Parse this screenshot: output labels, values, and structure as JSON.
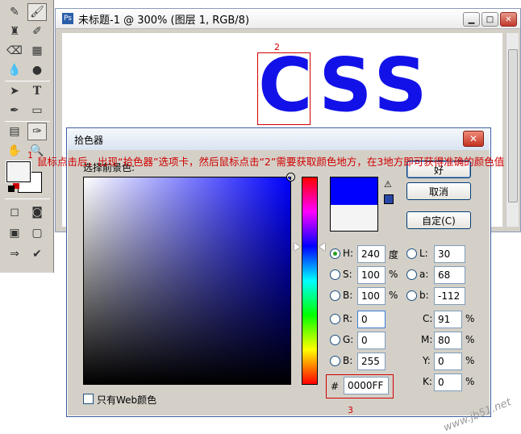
{
  "document": {
    "title": "未标题-1 @ 300% (图层 1, RGB/8)",
    "canvas_text": "CSS"
  },
  "annotations": {
    "marker_1": "1",
    "marker_2": "2",
    "marker_3": "3",
    "note": "鼠标点击后，出现“拾色器”选项卡，然后鼠标点击“2”需要获取颜色地方，在3地方即可获得准确的颜色值"
  },
  "picker": {
    "title": "拾色器",
    "label": "选择前景色:",
    "ok_label": "好",
    "cancel_label": "取消",
    "custom_label": "自定(C)",
    "web_only_label": "只有Web颜色",
    "hsb": {
      "h_label": "H:",
      "h_value": "240",
      "h_unit": "度",
      "s_label": "S:",
      "s_value": "100",
      "s_unit": "%",
      "b_label": "B:",
      "b_value": "100",
      "b_unit": "%"
    },
    "rgb": {
      "r_label": "R:",
      "r_value": "0",
      "g_label": "G:",
      "g_value": "0",
      "b_label": "B:",
      "b_value": "255"
    },
    "lab": {
      "l_label": "L:",
      "l_value": "30",
      "a_label": "a:",
      "a_value": "68",
      "b_label": "b:",
      "b_value": "-112"
    },
    "cmyk": {
      "c_label": "C:",
      "c_value": "91",
      "c_unit": "%",
      "m_label": "M:",
      "m_value": "80",
      "m_unit": "%",
      "y_label": "Y:",
      "y_value": "0",
      "y_unit": "%",
      "k_label": "K:",
      "k_value": "0",
      "k_unit": "%"
    },
    "hex_label": "#",
    "hex_value": "0000FF",
    "new_color": "#0000ff",
    "current_color": "#f4f4f4"
  },
  "watermark": "www.jb51.net",
  "colors": {
    "accent_blue": "#1212e8",
    "annotation_red": "#d00000"
  }
}
